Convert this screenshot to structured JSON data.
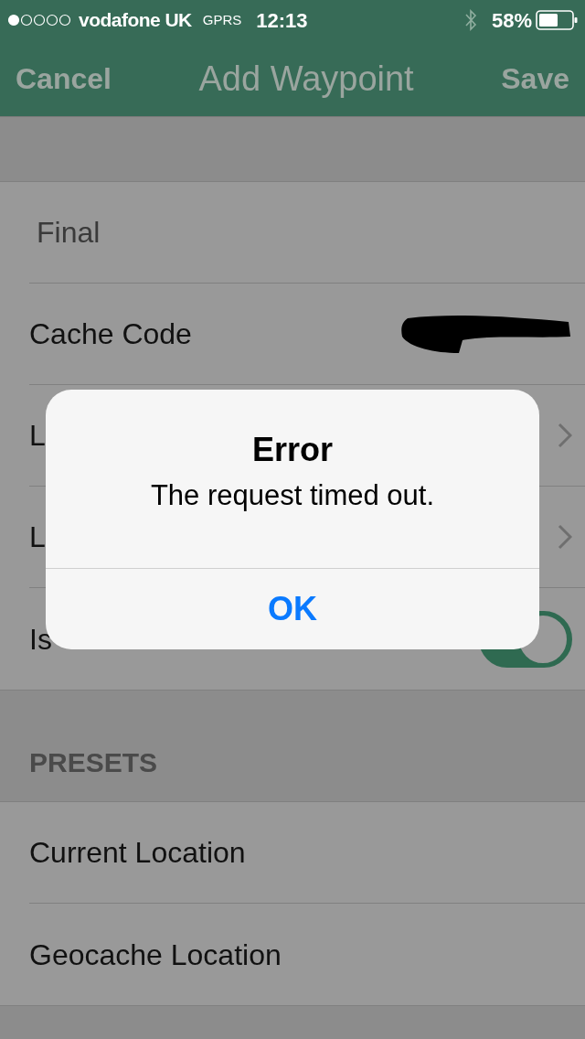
{
  "status_bar": {
    "carrier": "vodafone UK",
    "network": "GPRS",
    "time": "12:13",
    "battery": "58%"
  },
  "nav_bar": {
    "cancel": "Cancel",
    "title": "Add Waypoint",
    "save": "Save"
  },
  "form": [
    {
      "kind": "field",
      "value": "Final"
    },
    {
      "kind": "redacted",
      "label": "Cache Code"
    },
    {
      "kind": "disclosure",
      "label": "L"
    },
    {
      "kind": "disclosure",
      "label": "L"
    },
    {
      "kind": "toggle",
      "label": "Is",
      "on": true
    }
  ],
  "presets": {
    "header": "PRESETS",
    "items": [
      "Current Location",
      "Geocache Location"
    ]
  },
  "alert": {
    "title": "Error",
    "message": "The request timed out.",
    "button": "OK"
  }
}
